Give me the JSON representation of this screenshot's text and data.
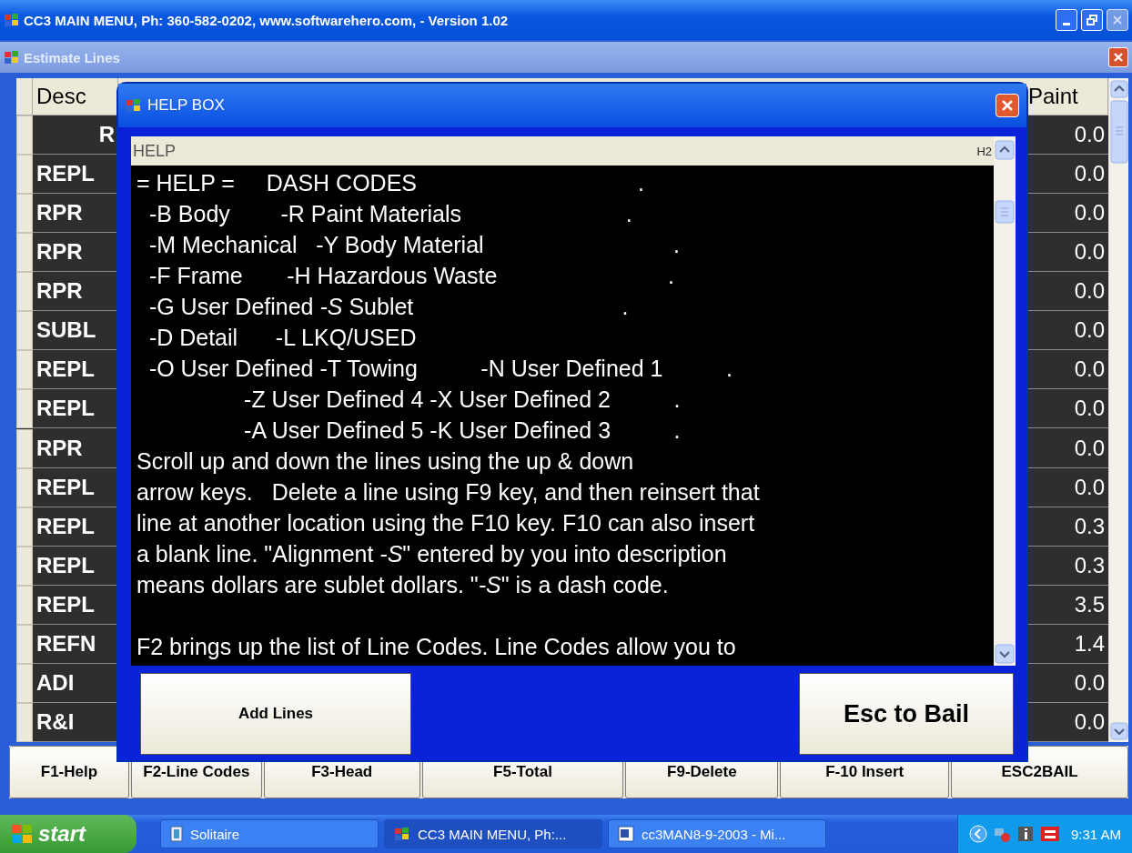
{
  "window": {
    "title": "CC3 MAIN MENU, Ph: 360-582-0202, www.softwarehero.com, - Version 1.02"
  },
  "child_window": {
    "title": "Estimate Lines"
  },
  "table": {
    "columns": [
      "Desc",
      "Paint"
    ],
    "rows": [
      {
        "desc": "R",
        "paint": "0.0"
      },
      {
        "desc": "REPL",
        "paint": "0.0"
      },
      {
        "desc": "RPR",
        "paint": "0.0"
      },
      {
        "desc": "RPR",
        "paint": "0.0"
      },
      {
        "desc": "RPR",
        "paint": "0.0"
      },
      {
        "desc": "SUBL",
        "paint": "0.0"
      },
      {
        "desc": "REPL",
        "paint": "0.0"
      },
      {
        "desc": "REPL",
        "paint": "0.0"
      },
      {
        "desc": "RPR",
        "paint": "0.0"
      },
      {
        "desc": "REPL",
        "paint": "0.0"
      },
      {
        "desc": "REPL",
        "paint": "0.3"
      },
      {
        "desc": "REPL",
        "paint": "0.3"
      },
      {
        "desc": "REPL",
        "paint": "3.5"
      },
      {
        "desc": "REFN",
        "paint": "1.4"
      },
      {
        "desc": "ADI",
        "paint": "0.0"
      },
      {
        "desc": "R&I",
        "paint": "0.0"
      }
    ]
  },
  "help_box": {
    "title": "HELP BOX",
    "header": "HELP",
    "header_tag": "H2",
    "lines": [
      "= HELP =     DASH CODES                                   .",
      "  -B Body        -R Paint Materials                          .",
      "  -M Mechanical   -Y Body Material                              .",
      "  -F Frame       -H Hazardous Waste                           .",
      "  -G User Defined *-S* Sublet                                 .",
      "  -D Detail      -L LKQ/USED",
      "  -O User Defined -T Towing          -N User Defined 1          .",
      "                 -Z User Defined 4 -X User Defined 2          .",
      "                 -A User Defined 5 -K User Defined 3          .",
      "Scroll up and down the lines using the up & down",
      "arrow keys.   Delete a line using F9 key, and then reinsert that",
      "line at another location using the F10 key. F10 can also insert",
      "a blank line. \"Alignment *-S*\" entered by you into description",
      "means dollars are sublet dollars. \"*-S*\" is a dash code."
    ],
    "after_gap": [
      "F2 brings up the list of Line Codes. Line Codes allow you to"
    ],
    "buttons": [
      "Add Lines",
      "Esc to Bail"
    ]
  },
  "function_keys": [
    "F1-Help",
    "F2-Line Codes",
    "F3-Head",
    "F5-Total",
    "F9-Delete",
    "F-10 Insert",
    "ESC2BAIL"
  ],
  "taskbar": {
    "start": "start",
    "items": [
      {
        "label": "Solitaire",
        "kind": "cards",
        "selected": false
      },
      {
        "label": "CC3 MAIN MENU, Ph:...",
        "kind": "app",
        "selected": true
      },
      {
        "label": "cc3MAN8-9-2003 - Mi...",
        "kind": "doc",
        "selected": false
      }
    ],
    "clock": "9:31 AM"
  }
}
